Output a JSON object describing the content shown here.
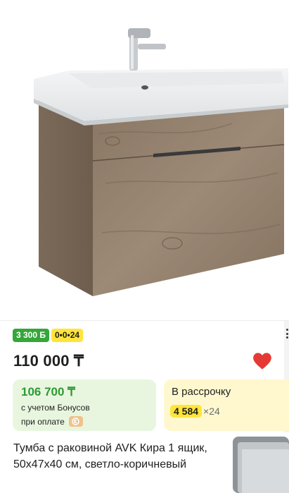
{
  "product": {
    "bonus_badge": "3 300 Б",
    "installment_badge": "0•0•24",
    "price": "110 000 ₸",
    "bonus_price": "106 700 ₸",
    "bonus_note_1": "с учетом Бонусов",
    "bonus_note_2": "при оплате",
    "installment_label": "В рассрочку",
    "installment_monthly": "4 584",
    "installment_term": "×24",
    "title": "Тумба с раковиной AVK Кира 1 ящик, 50х47х40 см, светло-коричневый"
  },
  "colors": {
    "bonus_green": "#35a63a",
    "accent_yellow": "#ffe53a",
    "heart_red": "#e53935"
  },
  "icons": [
    "heart-icon",
    "more-options-icon",
    "bonus-coin-icon"
  ]
}
